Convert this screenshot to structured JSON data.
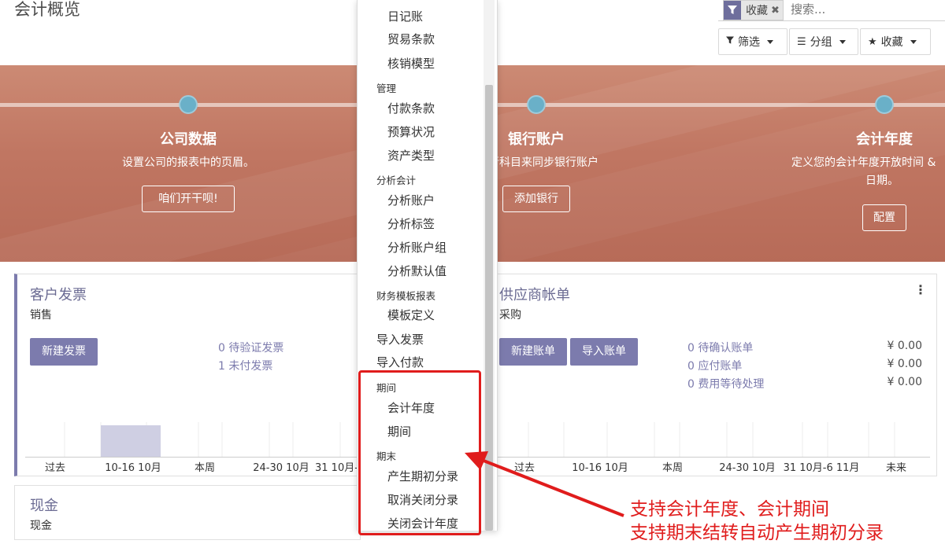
{
  "header": {
    "title": "会计概览",
    "search": {
      "facet_label": "收藏",
      "placeholder": "搜索..."
    },
    "buttons": {
      "filter": "筛选",
      "group": "分组",
      "favorites": "收藏"
    }
  },
  "banner": {
    "steps": [
      {
        "title": "公司数据",
        "desc": "设置公司的报表中的页眉。",
        "button": "咱们开干呗!"
      },
      {
        "title": "银行账户",
        "desc": "行科目来同步银行账户",
        "button": "添加银行"
      },
      {
        "title": "会计年度",
        "desc_line1": "定义您的会计年度开放时间 &",
        "desc_line2": "日期。",
        "button": "配置"
      }
    ]
  },
  "cards": {
    "customer": {
      "title": "客户发票",
      "subtitle": "销售",
      "button": "新建发票",
      "links": [
        "0 待验证发票",
        "1 未付发票"
      ],
      "ticks": [
        "过去",
        "10-16 10月",
        "本周",
        "24-30 10月",
        "31 10月-"
      ]
    },
    "vendor": {
      "title": "供应商帐单",
      "subtitle": "采购",
      "buttons": [
        "新建账单",
        "导入账单"
      ],
      "links": [
        "0 待确认账单",
        "0 应付账单",
        "0 费用等待处理"
      ],
      "amounts": [
        "¥ 0.00",
        "¥ 0.00",
        "¥ 0.00"
      ],
      "ticks": [
        "过去",
        "10-16 10月",
        "本周",
        "24-30 10月",
        "31 10月-6 11月",
        "未来"
      ]
    },
    "cash": {
      "title": "现金",
      "subtitle": "现金"
    }
  },
  "chart_data": {
    "type": "bar",
    "categories": [
      "过去",
      "10-16 10月",
      "本周",
      "24-30 10月",
      "31 10月-"
    ],
    "values": [
      0,
      1,
      0,
      0,
      0
    ],
    "highlight_color": "#cfcfe3"
  },
  "dropdown": {
    "items": [
      {
        "kind": "item",
        "label": "日记账"
      },
      {
        "kind": "item",
        "label": "贸易条款"
      },
      {
        "kind": "item",
        "label": "核销模型"
      },
      {
        "kind": "header",
        "label": "管理"
      },
      {
        "kind": "item",
        "label": "付款条款"
      },
      {
        "kind": "item",
        "label": "预算状况"
      },
      {
        "kind": "item",
        "label": "资产类型"
      },
      {
        "kind": "header",
        "label": "分析会计"
      },
      {
        "kind": "item",
        "label": "分析账户"
      },
      {
        "kind": "item",
        "label": "分析标签"
      },
      {
        "kind": "item",
        "label": "分析账户组"
      },
      {
        "kind": "item",
        "label": "分析默认值"
      },
      {
        "kind": "header",
        "label": "财务模板报表"
      },
      {
        "kind": "item",
        "label": "模板定义"
      },
      {
        "kind": "top",
        "label": "导入发票"
      },
      {
        "kind": "top",
        "label": "导入付款"
      },
      {
        "kind": "header",
        "label": "期间"
      },
      {
        "kind": "item",
        "label": "会计年度"
      },
      {
        "kind": "item",
        "label": "期间"
      },
      {
        "kind": "header",
        "label": "期末"
      },
      {
        "kind": "item",
        "label": "产生期初分录"
      },
      {
        "kind": "item",
        "label": "取消关闭分录"
      },
      {
        "kind": "item",
        "label": "关闭会计年度"
      }
    ]
  },
  "annotation": {
    "line1": "支持会计年度、会计期间",
    "line2": "支持期末结转自动产生期初分录",
    "color": "#e01c1c"
  },
  "colors": {
    "accent": "#7c7bad",
    "banner": "#c07662",
    "dot": "#6ab0c8"
  }
}
